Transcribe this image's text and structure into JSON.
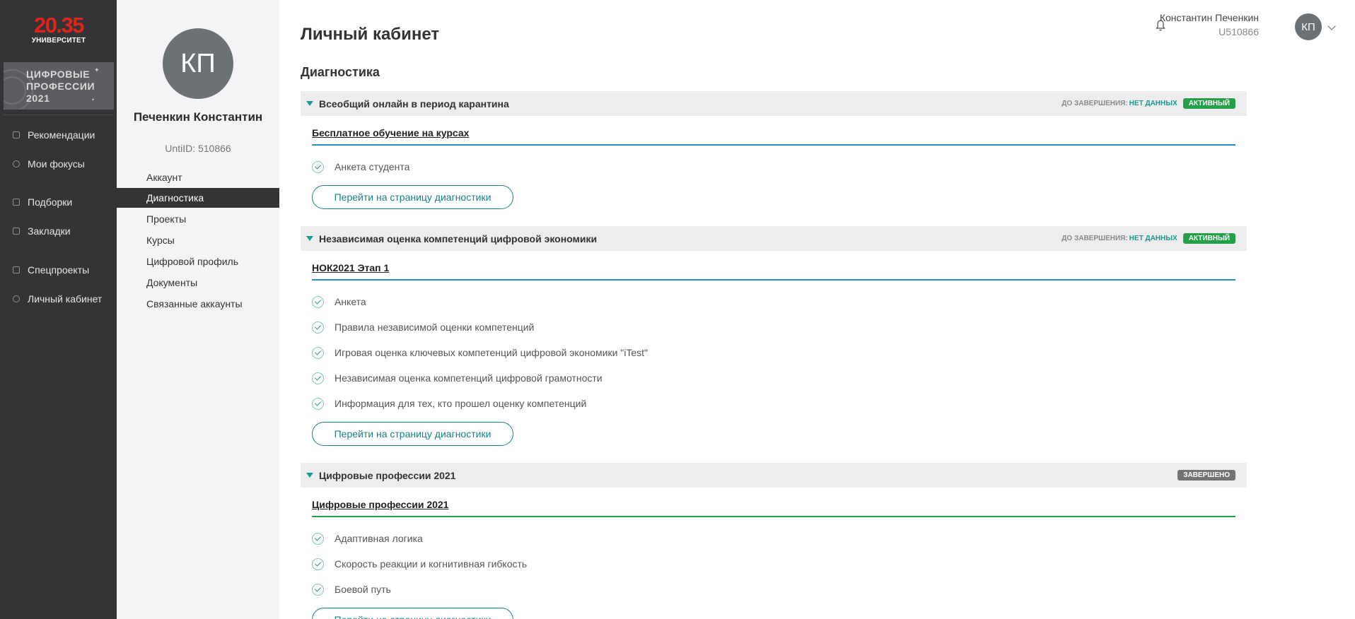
{
  "brand": {
    "logo_number": "20.35",
    "logo_sub": "УНИВЕРСИТЕТ",
    "promo_text": "ЦИФРОВЫЕ ПРОФЕССИИ 2021",
    "logo_color": "#e2231a"
  },
  "sidebar": {
    "items": [
      {
        "label": "Рекомендации",
        "icon": "recommendations-icon"
      },
      {
        "label": "Мои фокусы",
        "icon": "focus-icon"
      },
      {
        "label": "Подборки",
        "icon": "collections-icon"
      },
      {
        "label": "Закладки",
        "icon": "bookmark-icon"
      },
      {
        "label": "Спецпроекты",
        "icon": "special-projects-icon"
      },
      {
        "label": "Личный кабинет",
        "icon": "user-icon"
      }
    ]
  },
  "profile": {
    "initials": "КП",
    "name": "Печенкин Константин",
    "unti_id": "UntiID: 510866",
    "nav": [
      {
        "label": "Аккаунт",
        "active": false
      },
      {
        "label": "Диагностика",
        "active": true
      },
      {
        "label": "Проекты",
        "active": false
      },
      {
        "label": "Курсы",
        "active": false
      },
      {
        "label": "Цифровой профиль",
        "active": false
      },
      {
        "label": "Документы",
        "active": false
      },
      {
        "label": "Связанные аккаунты",
        "active": false
      }
    ]
  },
  "header": {
    "title": "Личный кабинет",
    "user_name": "Константин Печенкин",
    "user_id": "U510866",
    "user_initials": "КП"
  },
  "section_title": "Диагностика",
  "groups": [
    {
      "title": "Всеобщий онлайн в период карантина",
      "deadline_label": "ДО ЗАВЕРШЕНИЯ:",
      "deadline_value": "НЕТ ДАННЫХ",
      "status": "АКТИВНЫЙ",
      "subtitle": "Бесплатное обучение на курсах",
      "items": [
        "Анкета студента"
      ],
      "button": "Перейти на страницу диагностики"
    },
    {
      "title": "Независимая оценка компетенций цифровой экономики",
      "deadline_label": "ДО ЗАВЕРШЕНИЯ:",
      "deadline_value": "НЕТ ДАННЫХ",
      "status": "АКТИВНЫЙ",
      "subtitle": "НОК2021 Этап 1",
      "items": [
        "Анкета",
        "Правила независимой оценки компетенций",
        "Игровая оценка ключевых компетенций цифровой экономики \"iTest\"",
        "Независимая оценка компетенций цифровой грамотности",
        "Информация для тех, кто прошел оценку компетенций"
      ],
      "button": "Перейти на страницу диагностики"
    },
    {
      "title": "Цифровые профессии 2021",
      "status": "ЗАВЕРШЕНО",
      "subtitle": "Цифровые профессии 2021",
      "items": [
        "Адаптивная логика",
        "Скорость реакции и когнитивная гибкость",
        "Боевой путь"
      ],
      "button": "Перейти на страницу диагностики"
    }
  ],
  "colors": {
    "sidebar_bg": "#343437",
    "accent": "#1a9a90",
    "active_badge": "#24a148",
    "done_badge": "#737373"
  }
}
